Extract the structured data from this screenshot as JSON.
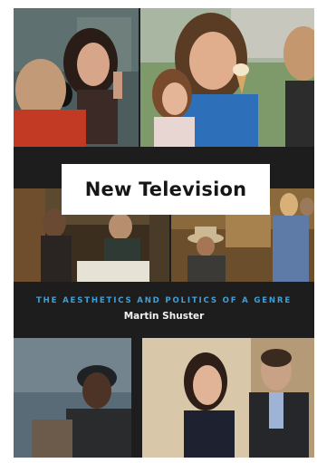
{
  "book": {
    "title": "New Television",
    "subtitle": "THE AESTHETICS AND POLITICS OF A GENRE",
    "author": "Martin Shuster"
  },
  "colors": {
    "background": "#1d1d1d",
    "title_box": "#ffffff",
    "subtitle_text": "#3f9fd6",
    "author_text": "#f1f1f1"
  }
}
